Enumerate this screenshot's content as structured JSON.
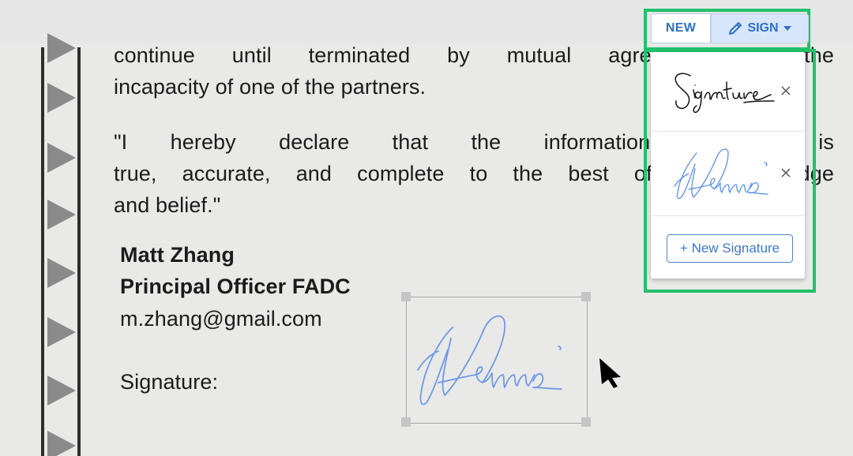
{
  "document": {
    "paragraph1_line1": "continue until terminated by mutual agreement or the",
    "paragraph1_line2": "incapacity of one of the partners.",
    "paragraph2_line1": "\"I hereby declare that the information provided is",
    "paragraph2_line2": "true, accurate, and complete to the best of my knowledge",
    "paragraph2_line3": "and belief.\"",
    "signer_name": "Matt Zhang",
    "signer_title": "Principal Officer FADC",
    "signer_email": "m.zhang@gmail.com",
    "signature_label": "Signature:"
  },
  "toolbar": {
    "new_label": "NEW",
    "sign_label": "SIGN"
  },
  "signature_menu": {
    "new_signature_label": "+ New Signature",
    "items": [
      {
        "signature_text": "Signature"
      },
      {
        "signature_text": "Dennis"
      }
    ]
  },
  "placed_signature": {
    "signature_text": "Dennis"
  },
  "colors": {
    "highlight": "#22c16a",
    "accent": "#2f6fc5",
    "signature_ink": "#5b8fe6"
  },
  "icons": {
    "page_marker": "triangle-right",
    "sign_button": "pencil-icon",
    "dropdown": "caret-down-icon",
    "remove": "close-icon",
    "pointer": "mouse-cursor-icon"
  }
}
